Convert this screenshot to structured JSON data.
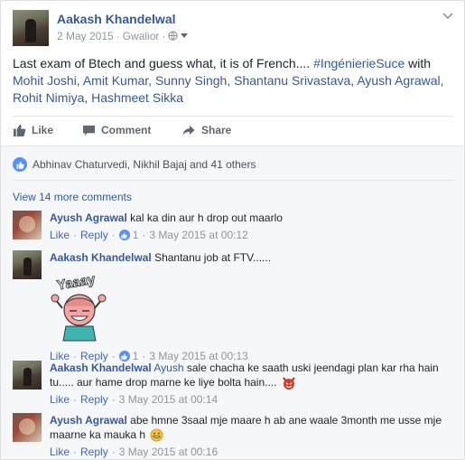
{
  "post": {
    "author": "Aakash Khandelwal",
    "date": "2 May 2015",
    "location": "Gwalior",
    "text_before": "Last exam of Btech and guess what, it is of French.... ",
    "hashtag": "#IngénierieSuce",
    "text_with": " with ",
    "tagged": "Mohit Joshi, Amit Kumar, Sunny Singh, Shantanu Srivastava, Ayush Agrawal, Rohit Nimiya, Hashmeet Sikka"
  },
  "actions": {
    "like": "Like",
    "comment": "Comment",
    "share": "Share"
  },
  "likes_summary": "Abhinav Chaturvedi, Nikhil Bajaj and 41 others",
  "view_more": "View 14 more comments",
  "comments": [
    {
      "author": "Ayush Agrawal",
      "text": "kal ka din aur h drop out maarlo",
      "like": "Like",
      "reply": "Reply",
      "likes": "1",
      "time": "3 May 2015 at 00:12"
    },
    {
      "author": "Aakash Khandelwal",
      "text": "Shantanu job at FTV......",
      "sticker_text": "Yaaay",
      "like": "Like",
      "reply": "Reply",
      "likes": "1",
      "time": "3 May 2015 at 00:13"
    },
    {
      "author": "Aakash Khandelwal",
      "mention": "Ayush",
      "text": " sale chacha ke saath uski jeendagi plan kar rha hain tu..... aur hame drop marne ke liye bolta hain....",
      "like": "Like",
      "reply": "Reply",
      "time": "3 May 2015 at 00:14"
    },
    {
      "author": "Ayush Agrawal",
      "text": "abe hmne 3saal mje maare h ab ane waale 3month me usse mje maarne ka mauka h",
      "like": "Like",
      "reply": "Reply",
      "time": "3 May 2015 at 00:16"
    }
  ],
  "colors": {
    "link": "#365899",
    "meta": "#90949c",
    "like_blue": "#5890ff",
    "background": "#f6f7f9"
  },
  "icons": [
    "globe-icon",
    "dropdown-arrow-icon",
    "chevron-down-icon",
    "like-thumb-icon",
    "comment-icon",
    "share-icon",
    "devil-emoji-icon",
    "grin-emoji-icon"
  ]
}
